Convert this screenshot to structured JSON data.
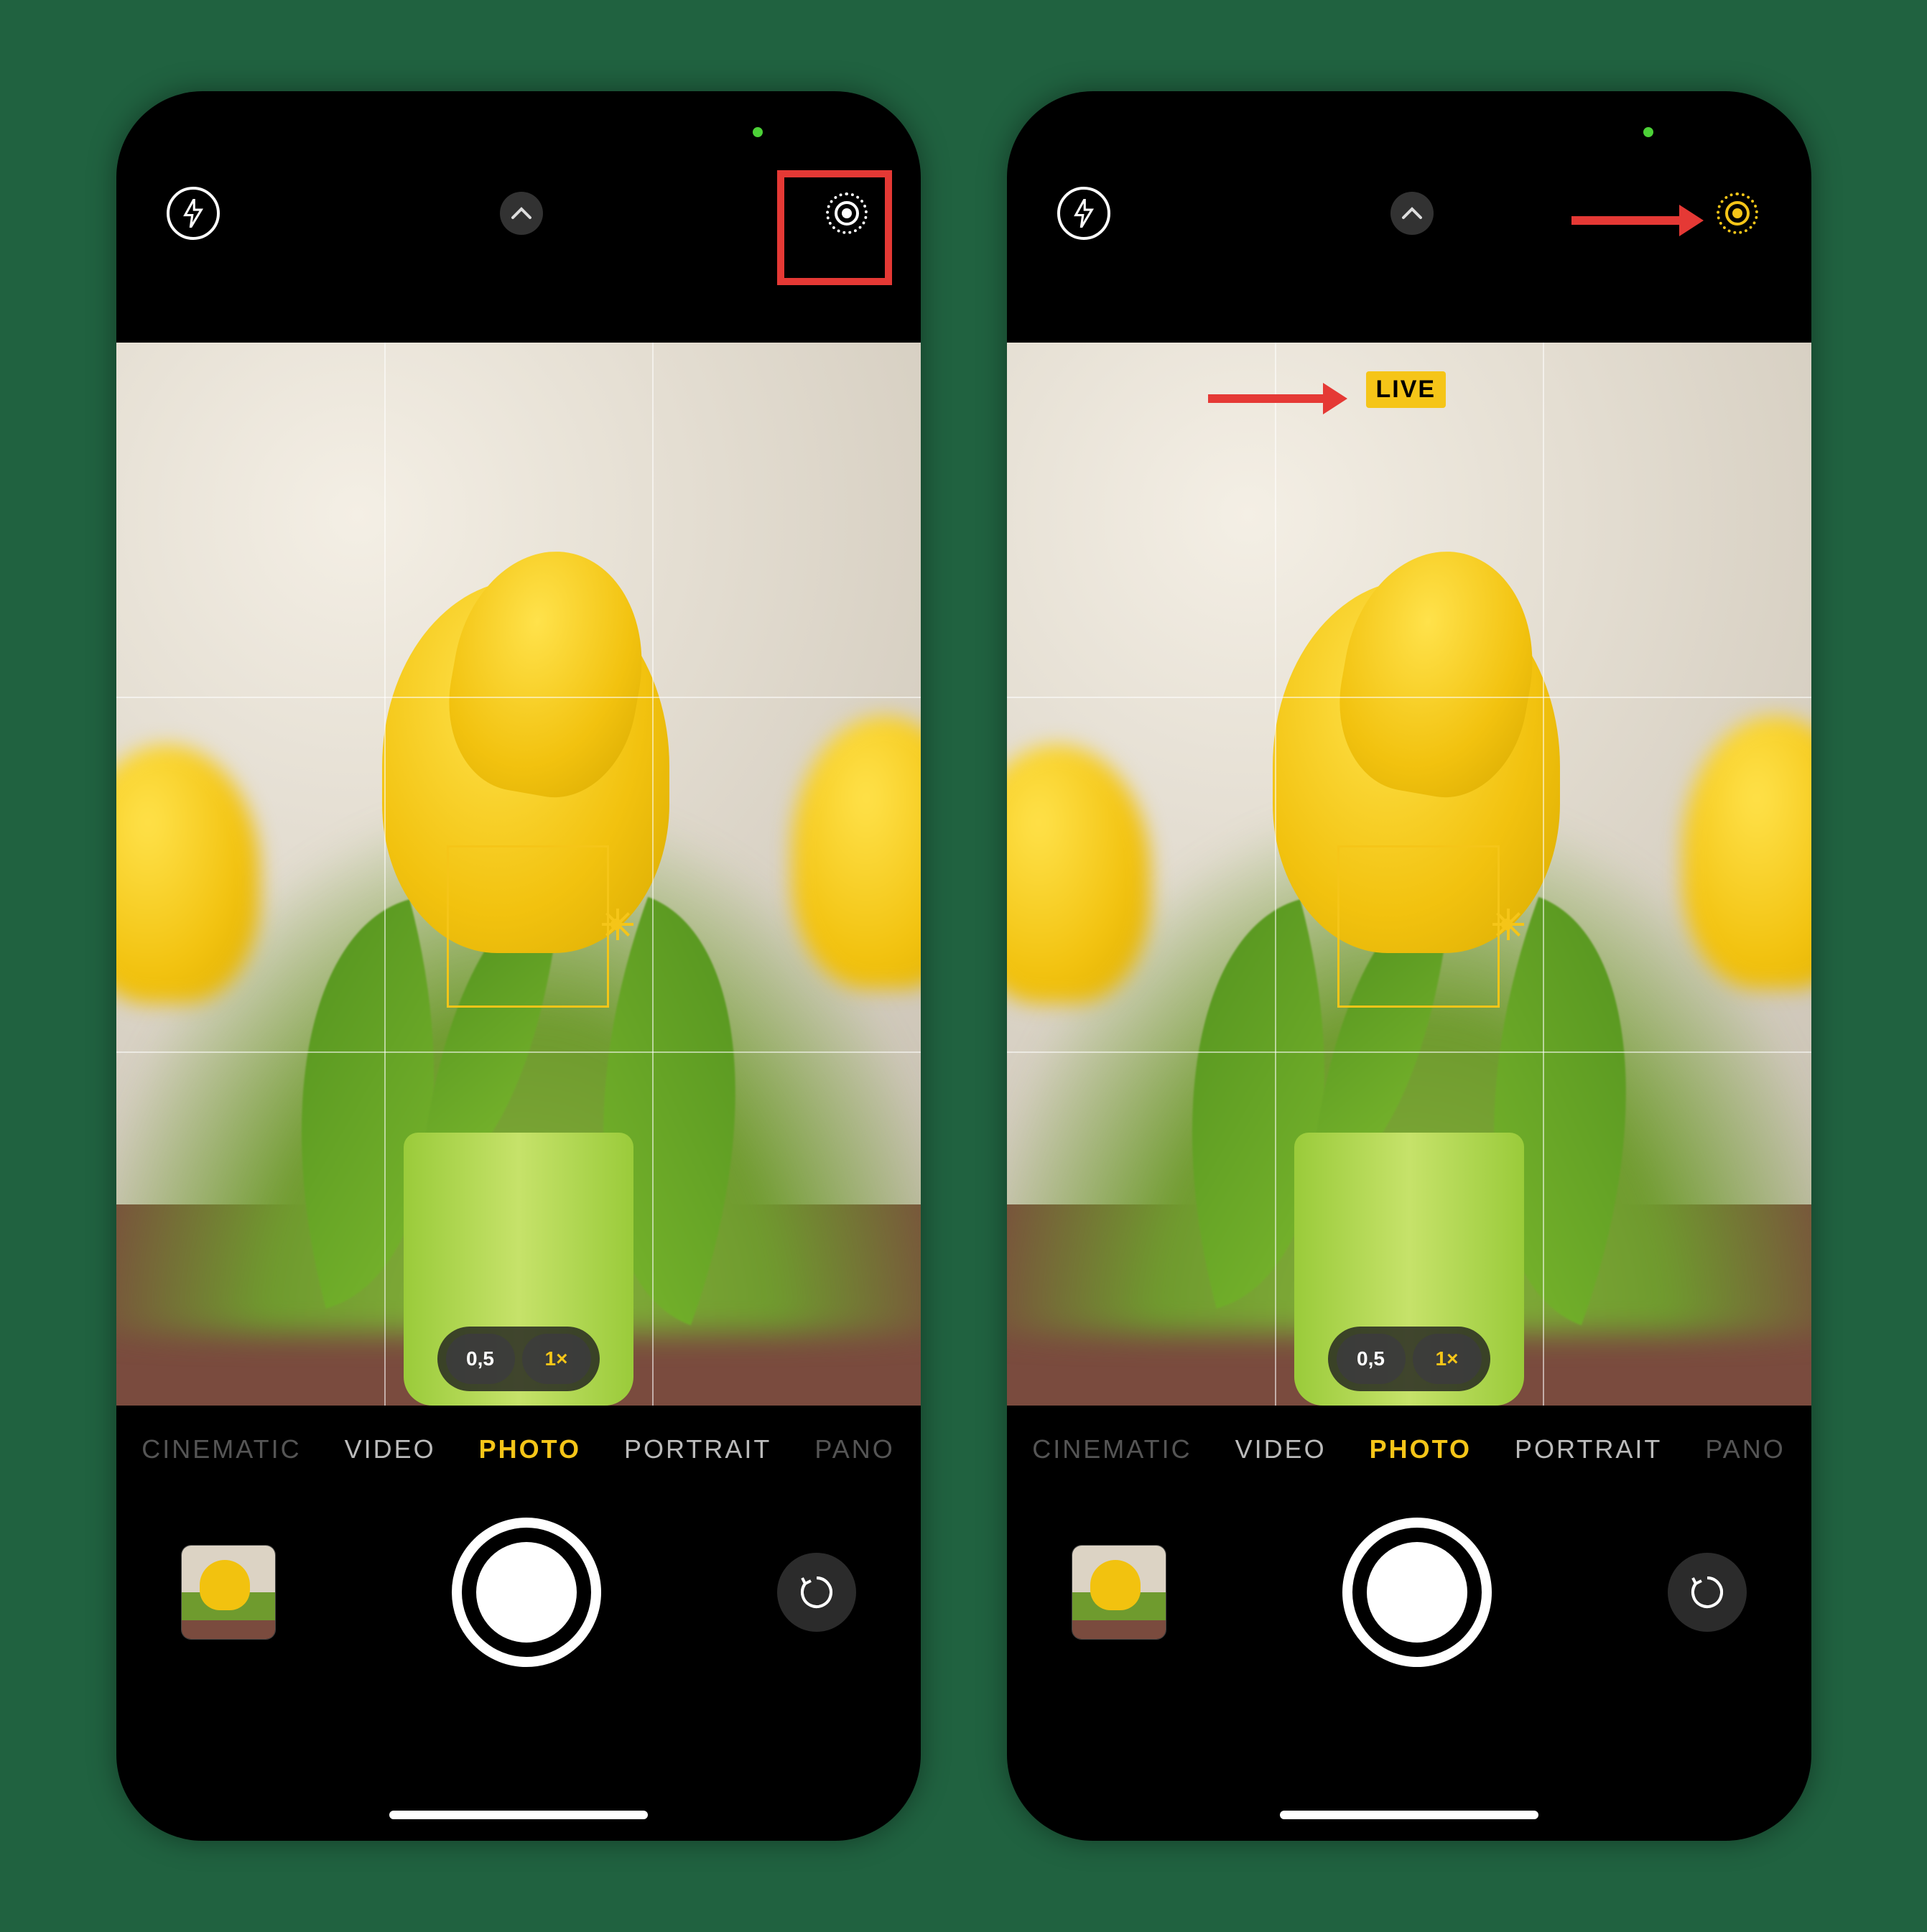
{
  "shared": {
    "zoom": {
      "wide": "0,5",
      "standard": "1×",
      "active_index": 1
    },
    "modes": [
      "CINEMATIC",
      "VIDEO",
      "PHOTO",
      "PORTRAIT",
      "PANO"
    ],
    "active_mode_index": 2,
    "icons": {
      "flash": "flash-icon",
      "chevron": "chevron-up-icon",
      "live": "live-photo-icon",
      "flip": "camera-flip-icon"
    }
  },
  "left": {
    "live_active": false,
    "annotation": {
      "type": "red-box-around-live-icon"
    }
  },
  "right": {
    "live_active": true,
    "live_badge_text": "LIVE",
    "annotations": [
      {
        "type": "red-arrow-to-live-icon"
      },
      {
        "type": "red-arrow-to-live-badge"
      }
    ]
  },
  "colors": {
    "accent": "#f5c518",
    "annotation": "#e53935"
  }
}
